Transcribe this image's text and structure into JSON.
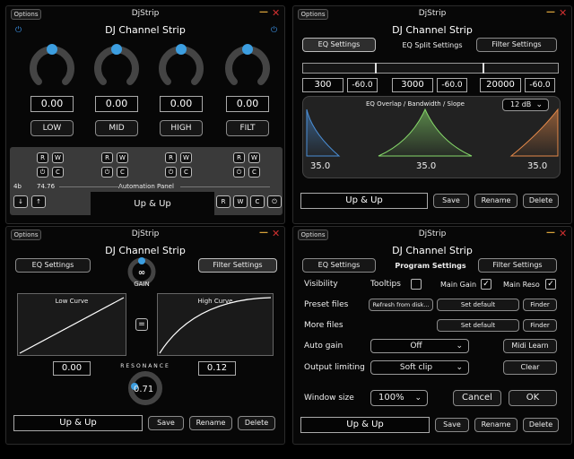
{
  "common": {
    "options_label": "Options",
    "window_title": "DjStrip",
    "app_title": "DJ Channel Strip",
    "preset_name": "Up & Up",
    "save_label": "Save",
    "rename_label": "Rename",
    "delete_label": "Delete"
  },
  "strip": {
    "knobs": [
      {
        "value": "0.00",
        "label": "LOW",
        "level": 0.5
      },
      {
        "value": "0.00",
        "label": "MID",
        "level": 0.5
      },
      {
        "value": "0.00",
        "label": "HIGH",
        "level": 0.5
      },
      {
        "value": "0.00",
        "label": "FILT",
        "level": 0.5
      }
    ],
    "mini_labels": {
      "r": "R",
      "w": "W",
      "c": "C"
    },
    "automation": {
      "bits": "4b",
      "value": "74.76",
      "title": "Automation Panel"
    }
  },
  "eq": {
    "eq_tab": "EQ Settings",
    "header": "EQ Split Settings",
    "filter_tab": "Filter Settings",
    "splits": [
      {
        "freq": "300",
        "gain": "-60.0"
      },
      {
        "freq": "3000",
        "gain": "-60.0"
      },
      {
        "freq": "20000",
        "gain": "-60.0"
      }
    ],
    "graph_title": "EQ Overlap / Bandwidth / Slope",
    "slope": "12 dB",
    "slope_values": [
      "35.0",
      "35.0",
      "35.0"
    ],
    "band_colors": [
      "#4a8fd8",
      "#86d96a",
      "#e68a4a"
    ]
  },
  "filter": {
    "eq_tab": "EQ Settings",
    "filter_tab": "Filter Settings",
    "gain_label": "GAIN",
    "gain_symbol": "∞",
    "low_curve": {
      "title": "Low Curve",
      "value": "0.00"
    },
    "link_symbol": "=",
    "high_curve": {
      "title": "High Curve",
      "value": "0.12"
    },
    "resonance_label": "RESONANCE",
    "resonance_value": "0.71"
  },
  "program": {
    "eq_tab": "EQ Settings",
    "header": "Program Settings",
    "filter_tab": "Filter Settings",
    "visibility": "Visibility",
    "tooltips": "Tooltips",
    "tooltips_checked": false,
    "main_gain": "Main Gain",
    "main_gain_checked": true,
    "main_reso": "Main Reso",
    "main_reso_checked": true,
    "preset_files": "Preset files",
    "refresh": "Refresh from disk...",
    "set_default": "Set default",
    "finder": "Finder",
    "more_files": "More files",
    "auto_gain": "Auto gain",
    "auto_gain_value": "Off",
    "midi_learn": "Midi Learn",
    "output_limiting": "Output limiting",
    "output_limiting_value": "Soft clip",
    "clear": "Clear",
    "window_size": "Window size",
    "window_size_value": "100%",
    "cancel": "Cancel",
    "ok": "OK",
    "check_mark": "✓"
  }
}
